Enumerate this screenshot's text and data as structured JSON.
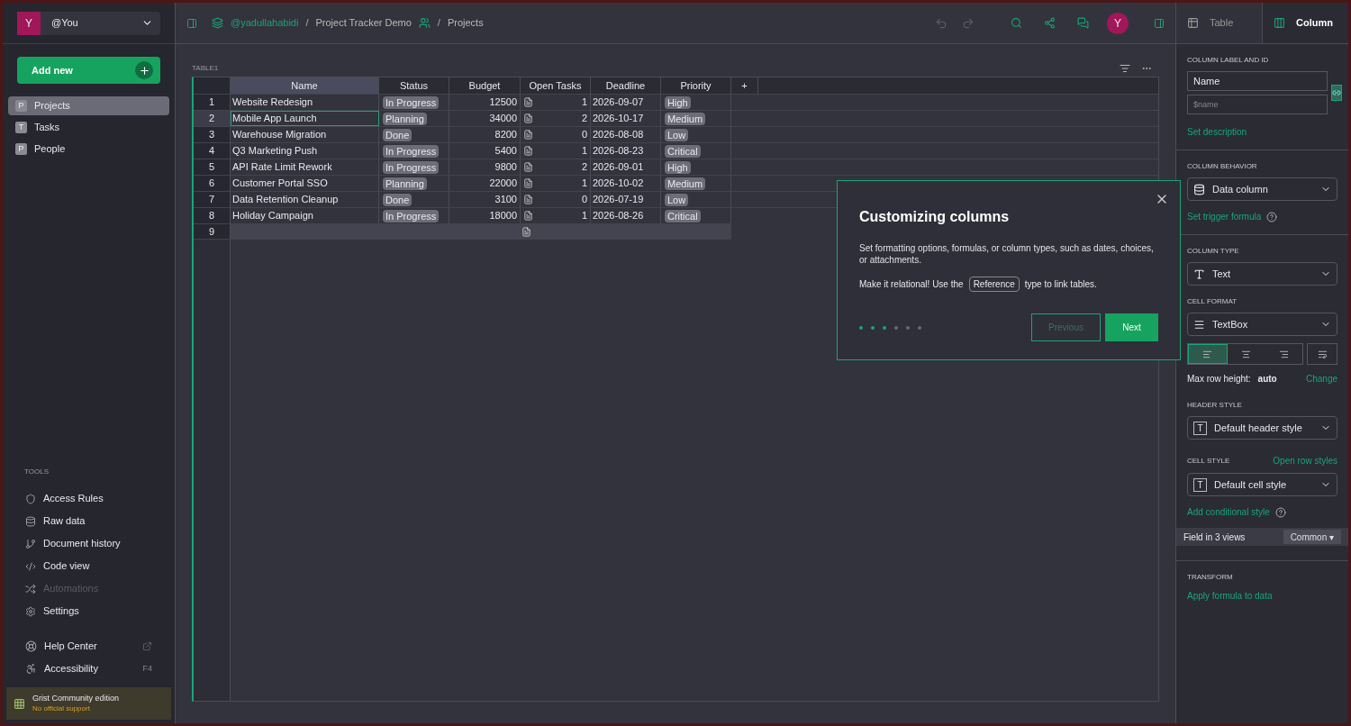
{
  "account": {
    "initial": "Y",
    "name": "@You"
  },
  "add_new": "Add new",
  "pages": [
    {
      "icon": "P",
      "label": "Projects",
      "selected": true
    },
    {
      "icon": "T",
      "label": "Tasks",
      "selected": false
    },
    {
      "icon": "P",
      "label": "People",
      "selected": false
    }
  ],
  "tools": {
    "heading": "TOOLS",
    "items": [
      {
        "kind": "access",
        "label": "Access Rules",
        "disabled": false
      },
      {
        "kind": "raw",
        "label": "Raw data",
        "disabled": false
      },
      {
        "kind": "history",
        "label": "Document history",
        "disabled": false
      },
      {
        "kind": "code",
        "label": "Code view",
        "disabled": false
      },
      {
        "kind": "automations",
        "label": "Automations",
        "disabled": true
      },
      {
        "kind": "settings",
        "label": "Settings",
        "disabled": false
      }
    ]
  },
  "help": [
    {
      "kind": "help",
      "label": "Help Center",
      "external": true
    },
    {
      "kind": "accessibility",
      "label": "Accessibility",
      "trailing": "F4"
    }
  ],
  "edition": {
    "title": "Grist Community edition",
    "note": "No official support"
  },
  "breadcrumb": {
    "separator_1": "/",
    "separator_2": "/",
    "owner": "@yadullahabidi",
    "document": "Project Tracker Demo",
    "page": "Projects"
  },
  "user_initial": "Y",
  "table": {
    "title": "TABLE1",
    "columns": [
      {
        "label": "Name",
        "selected": true
      },
      {
        "label": "Status",
        "selected": false
      },
      {
        "label": "Budget",
        "selected": false
      },
      {
        "label": "Open Tasks",
        "selected": false
      },
      {
        "label": "Deadline",
        "selected": false
      },
      {
        "label": "Priority",
        "selected": false
      }
    ],
    "add_column": "+",
    "rows": [
      {
        "n": "1",
        "name": "Website Redesign",
        "status": "In Progress",
        "budget": "12500",
        "tasks": "1",
        "deadline": "2026-09-07",
        "priority": "High",
        "selected": false
      },
      {
        "n": "2",
        "name": "Mobile App Launch",
        "status": "Planning",
        "budget": "34000",
        "tasks": "2",
        "deadline": "2026-10-17",
        "priority": "Medium",
        "selected": true
      },
      {
        "n": "3",
        "name": "Warehouse Migration",
        "status": "Done",
        "budget": "8200",
        "tasks": "0",
        "deadline": "2026-08-08",
        "priority": "Low",
        "selected": false
      },
      {
        "n": "4",
        "name": "Q3 Marketing Push",
        "status": "In Progress",
        "budget": "5400",
        "tasks": "1",
        "deadline": "2026-08-23",
        "priority": "Critical",
        "selected": false
      },
      {
        "n": "5",
        "name": "API Rate Limit Rework",
        "status": "In Progress",
        "budget": "9800",
        "tasks": "2",
        "deadline": "2026-09-01",
        "priority": "High",
        "selected": false
      },
      {
        "n": "6",
        "name": "Customer Portal SSO",
        "status": "Planning",
        "budget": "22000",
        "tasks": "1",
        "deadline": "2026-10-02",
        "priority": "Medium",
        "selected": false
      },
      {
        "n": "7",
        "name": "Data Retention Cleanup",
        "status": "Done",
        "budget": "3100",
        "tasks": "0",
        "deadline": "2026-07-19",
        "priority": "Low",
        "selected": false
      },
      {
        "n": "8",
        "name": "Holiday Campaign",
        "status": "In Progress",
        "budget": "18000",
        "tasks": "1",
        "deadline": "2026-08-26",
        "priority": "Critical",
        "selected": false
      }
    ],
    "new_row": "9"
  },
  "tour": {
    "title": "Customizing columns",
    "text": "Set formatting options, formulas, or column types, such as dates, choices, or attachments.",
    "text2_before": "Make it relational! Use the",
    "text2_tag": "Reference",
    "text2_after": "type to link tables.",
    "steps": [
      {
        "done": true
      },
      {
        "done": true
      },
      {
        "done": true
      },
      {
        "done": false
      },
      {
        "done": false
      },
      {
        "done": false
      }
    ],
    "previous": "Previous",
    "next": "Next"
  },
  "panel": {
    "tabs": [
      {
        "label": "Table",
        "selected": false
      },
      {
        "label": "Column",
        "selected": true
      }
    ],
    "label_heading": "COLUMN LABEL AND ID",
    "label_value": "Name",
    "id_value": "$name",
    "set_description": "Set description",
    "behavior_heading": "COLUMN BEHAVIOR",
    "behavior": "Data column",
    "trigger": "Set trigger formula",
    "type_heading": "COLUMN TYPE",
    "type": "Text",
    "format_heading": "CELL FORMAT",
    "format": "TextBox",
    "align": [
      {
        "kind": "left",
        "selected": true
      },
      {
        "kind": "center",
        "selected": false
      },
      {
        "kind": "right",
        "selected": false
      }
    ],
    "max_row_label": "Max row height:",
    "max_row_value": "auto",
    "change": "Change",
    "style_icon_letter_1": "T",
    "style_icon_letter_2": "T",
    "header_heading": "HEADER STYLE",
    "header_style": "Default header style",
    "cell_heading": "CELL STYLE",
    "row_styles": "Open row styles",
    "cell_style": "Default cell style",
    "conditional": "Add conditional style",
    "field_views": "Field in 3 views",
    "common": "Common ▾",
    "transform_heading": "TRANSFORM",
    "apply_formula": "Apply formula to data"
  }
}
